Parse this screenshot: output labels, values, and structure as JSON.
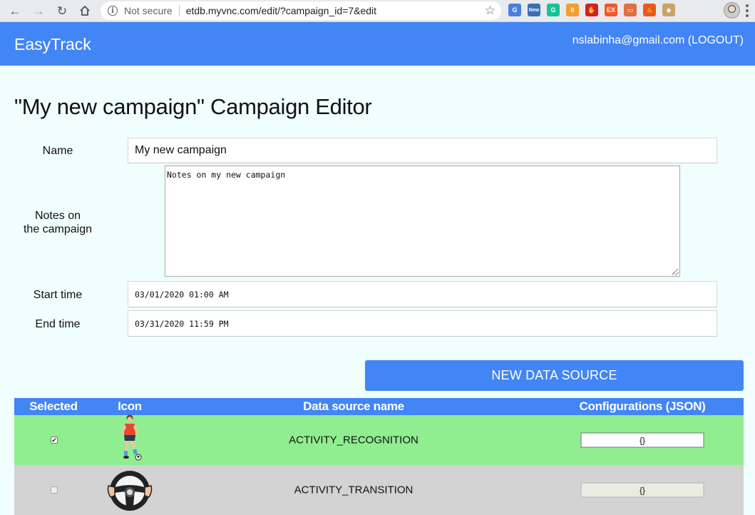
{
  "browser": {
    "security_label": "Not secure",
    "url": "etdb.myvnc.com/edit/?campaign_id=7&edit",
    "extensions": [
      {
        "name": "translate-ext-icon",
        "color": "#4a7fe0",
        "glyph": "G"
      },
      {
        "name": "new-ext-icon",
        "color": "#3a6fb5",
        "glyph": "New"
      },
      {
        "name": "grammarly-ext-icon",
        "color": "#15c39a",
        "glyph": "G"
      },
      {
        "name": "honey-ext-icon",
        "color": "#f0a030",
        "glyph": "0"
      },
      {
        "name": "adblock-ext-icon",
        "color": "#d32020",
        "glyph": "✋"
      },
      {
        "name": "ex-ext-icon",
        "color": "#f05a28",
        "glyph": "EX"
      },
      {
        "name": "window-ext-icon",
        "color": "#e07040",
        "glyph": "▭"
      },
      {
        "name": "flame-ext-icon",
        "color": "#e85a1a",
        "glyph": "♨"
      },
      {
        "name": "diamond-ext-icon",
        "color": "#c9a46a",
        "glyph": "◆"
      }
    ]
  },
  "header": {
    "brand": "EasyTrack",
    "account": "nslabinha@gmail.com (LOGOUT)"
  },
  "editor": {
    "title": "\"My new campaign\" Campaign Editor",
    "name_label": "Name",
    "name_value": "My new campaign",
    "notes_label_line1": "Notes on",
    "notes_label_line2": "the campaign",
    "notes_value": "Notes on my new campaign",
    "start_label": "Start time",
    "start_value": "03/01/2020 01:00 AM",
    "end_label": "End time",
    "end_value": "03/31/2020 11:59 PM",
    "new_data_source_label": "NEW DATA SOURCE"
  },
  "table": {
    "headers": [
      "Selected",
      "Icon",
      "Data source name",
      "Configurations (JSON)"
    ],
    "rows": [
      {
        "selected": true,
        "icon": "soccer-player-icon",
        "name": "ACTIVITY_RECOGNITION",
        "config": "{}",
        "enabled": true
      },
      {
        "selected": false,
        "icon": "steering-wheel-icon",
        "name": "ACTIVITY_TRANSITION",
        "config": "{}",
        "enabled": false
      }
    ]
  }
}
